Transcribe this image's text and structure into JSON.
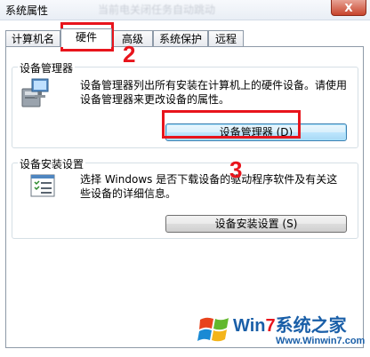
{
  "window": {
    "title": "系统属性",
    "ghost_title": "当前电关闭任务自动跳动",
    "close_label": "X"
  },
  "tabs": [
    {
      "label": "计算机名"
    },
    {
      "label": "硬件"
    },
    {
      "label": "高级"
    },
    {
      "label": "系统保护"
    },
    {
      "label": "远程"
    }
  ],
  "active_tab": "硬件",
  "device_manager": {
    "title": "设备管理器",
    "description": "设备管理器列出所有安装在计算机上的硬件设备。请使用设备管理器来更改设备的属性。",
    "button_label": "设备管理器 (D)"
  },
  "device_install": {
    "title": "设备安装设置",
    "description": "选择 Windows 是否下载设备的驱动程序软件及有关这些设备的详细信息。",
    "button_label": "设备安装设置 (S)"
  },
  "annotations": {
    "step2": "2",
    "step3": "3"
  },
  "watermark": {
    "brand_win": "Win",
    "brand_7": "7",
    "brand_rest": "系统之家",
    "url": "Www.Winwin7.com"
  },
  "colors": {
    "annotation_red": "#e8141c",
    "button_focus_blue": "#3c7fb1"
  }
}
